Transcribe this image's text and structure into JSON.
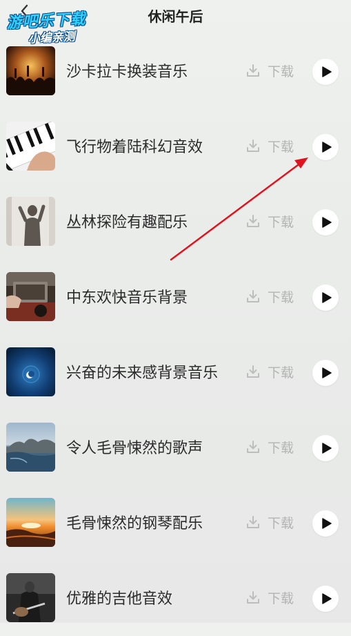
{
  "header": {
    "title": "休闲午后"
  },
  "watermark": {
    "line1": "游吧乐下载",
    "line2": "小编亲测"
  },
  "tracks": [
    {
      "title": "沙卡拉卡换装音乐",
      "download_label": "下载",
      "thumb": "concert"
    },
    {
      "title": "飞行物着陆科幻音效",
      "download_label": "下载",
      "thumb": "piano"
    },
    {
      "title": "丛林探险有趣配乐",
      "download_label": "下载",
      "thumb": "silhouette"
    },
    {
      "title": "中东欢快音乐背景",
      "download_label": "下载",
      "thumb": "record"
    },
    {
      "title": "兴奋的未来感背景音乐",
      "download_label": "下载",
      "thumb": "moon"
    },
    {
      "title": "令人毛骨悚然的歌声",
      "download_label": "下载",
      "thumb": "coast"
    },
    {
      "title": "毛骨悚然的钢琴配乐",
      "download_label": "下载",
      "thumb": "sunset"
    },
    {
      "title": "优雅的吉他音效",
      "download_label": "下载",
      "thumb": "guitar"
    }
  ],
  "icons": {
    "download": "download-icon",
    "play": "play-icon",
    "back": "back-icon"
  },
  "colors": {
    "accent_arrow": "#e0141e",
    "muted_text": "#b3b3b3",
    "title_text": "#2b2b2b"
  }
}
